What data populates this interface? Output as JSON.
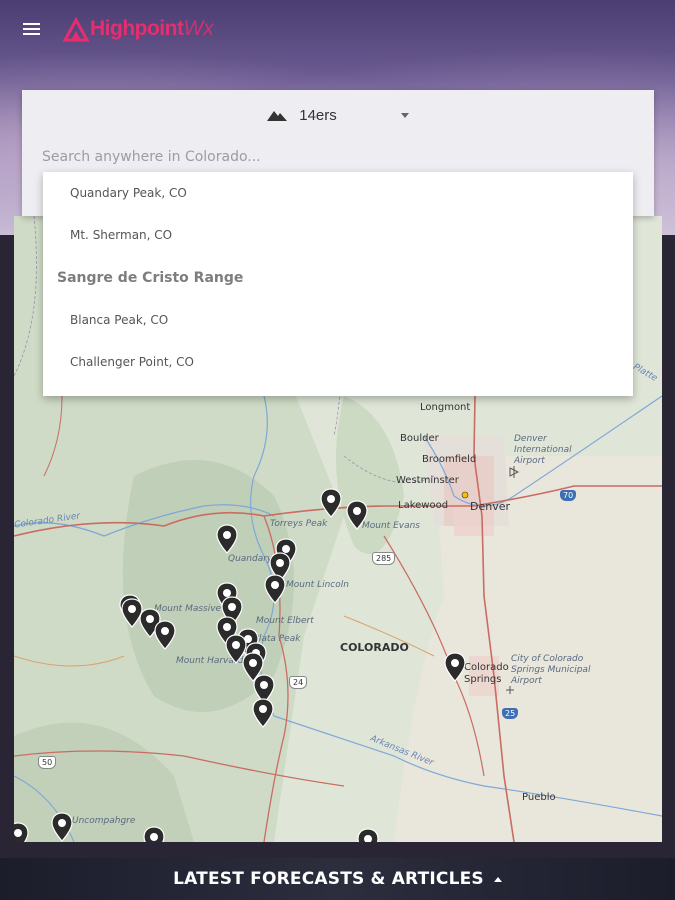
{
  "header": {
    "menu_icon": "hamburger-menu-icon",
    "logo_text_a": "Highpoint",
    "logo_text_b": "Wx",
    "brand_color": "#e62d6e"
  },
  "search": {
    "selector_icon": "mountain-icon",
    "selector_label": "14ers",
    "placeholder": "Search anywhere in Colorado..."
  },
  "dropdown": {
    "items": [
      {
        "label": "Quandary Peak, CO"
      },
      {
        "label": "Mt. Sherman, CO"
      },
      {
        "group": "Sangre de Cristo Range"
      },
      {
        "label": "Blanca Peak, CO"
      },
      {
        "label": "Challenger Point, CO"
      }
    ]
  },
  "map": {
    "labels": {
      "longmont": "Longmont",
      "boulder": "Boulder",
      "broomfield": "Broomfield",
      "westminster": "Westminster",
      "lakewood": "Lakewood",
      "denver": "Denver",
      "denver_airport": "Denver International Airport",
      "torreys": "Torreys Peak",
      "evans": "Mount Evans",
      "quandary": "Quandary",
      "lincoln": "Mount Lincoln",
      "massive": "Mount Massive",
      "elbert": "Mount Elbert",
      "la_plata": "La Plata Peak",
      "harvard": "Mount Harvard",
      "colorado": "COLORADO",
      "springs_city": "Colorado Springs",
      "springs_airport": "City of Colorado Springs Municipal Airport",
      "arkansas": "Arkansas River",
      "pueblo": "Pueblo",
      "colorado_river": "Colorado River",
      "uncompahgre": "Uncompahgre",
      "platte": "Platte",
      "i70": "70",
      "i25": "25",
      "us285": "285",
      "us24": "24",
      "us50": "50"
    },
    "pin_icon": "map-pin-icon"
  },
  "footer": {
    "label": "LATEST FORECASTS & ARTICLES",
    "caret_icon": "caret-up-icon"
  }
}
